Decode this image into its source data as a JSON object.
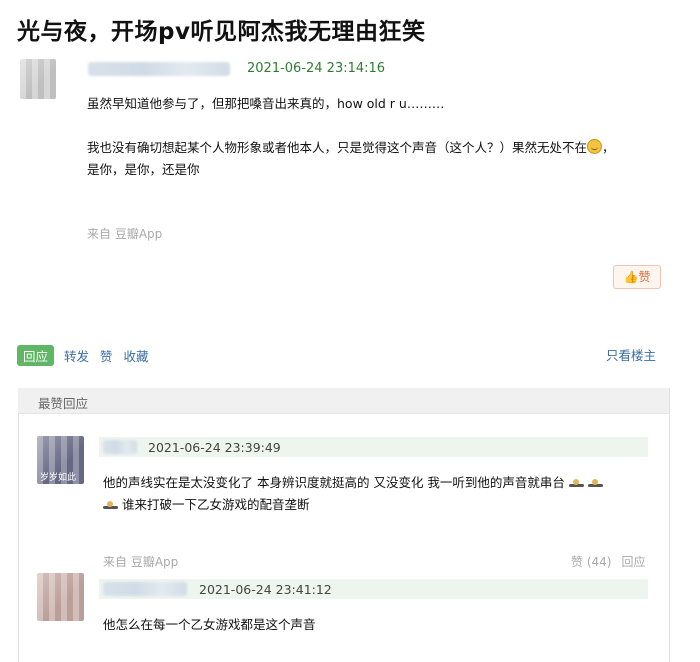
{
  "page": {
    "title": "光与夜，开场pv听见阿杰我无理由狂笑"
  },
  "post": {
    "timestamp": "2021-06-24 23:14:16",
    "paragraph_1": "虽然早知道他参与了，但那把嗓音出来真的，how old r u………",
    "paragraph_2_line_1": "我也没有确切想起某个人物形象或者他本人，只是觉得这个声音（这个人？）果然无处不在",
    "paragraph_2_line_1_tail": "，",
    "paragraph_2_line_2": "是你，是你，还是你",
    "source": "来自 豆瓣App",
    "like_label": "赞",
    "like_icon": "thumbs-up-icon"
  },
  "actions": {
    "reply": "回应",
    "forward": "转发",
    "like": "赞",
    "collect": "收藏",
    "only_op": "只看楼主"
  },
  "hot_replies": {
    "section_title": "最赞回应",
    "items": [
      {
        "avatar_text": "岁岁如此",
        "timestamp": "2021-06-24 23:39:49",
        "line_1": "他的声线实在是太没变化了 本身辨识度就挺高的 又没变化 我一听到他的声音就串台",
        "line_2": "谁来打破一下乙女游戏的配音垄断",
        "source": "来自 豆瓣App",
        "like_label": "赞 (44)",
        "reply_label": "回应"
      },
      {
        "timestamp": "2021-06-24 23:41:12",
        "line_1": "他怎么在每一个乙女游戏都是这个声音"
      }
    ]
  },
  "colors": {
    "timestamp_green": "#2e7d32",
    "link_blue": "#3a6ea5",
    "reply_pill_green": "#5fb664",
    "like_orange": "#d8703f"
  }
}
